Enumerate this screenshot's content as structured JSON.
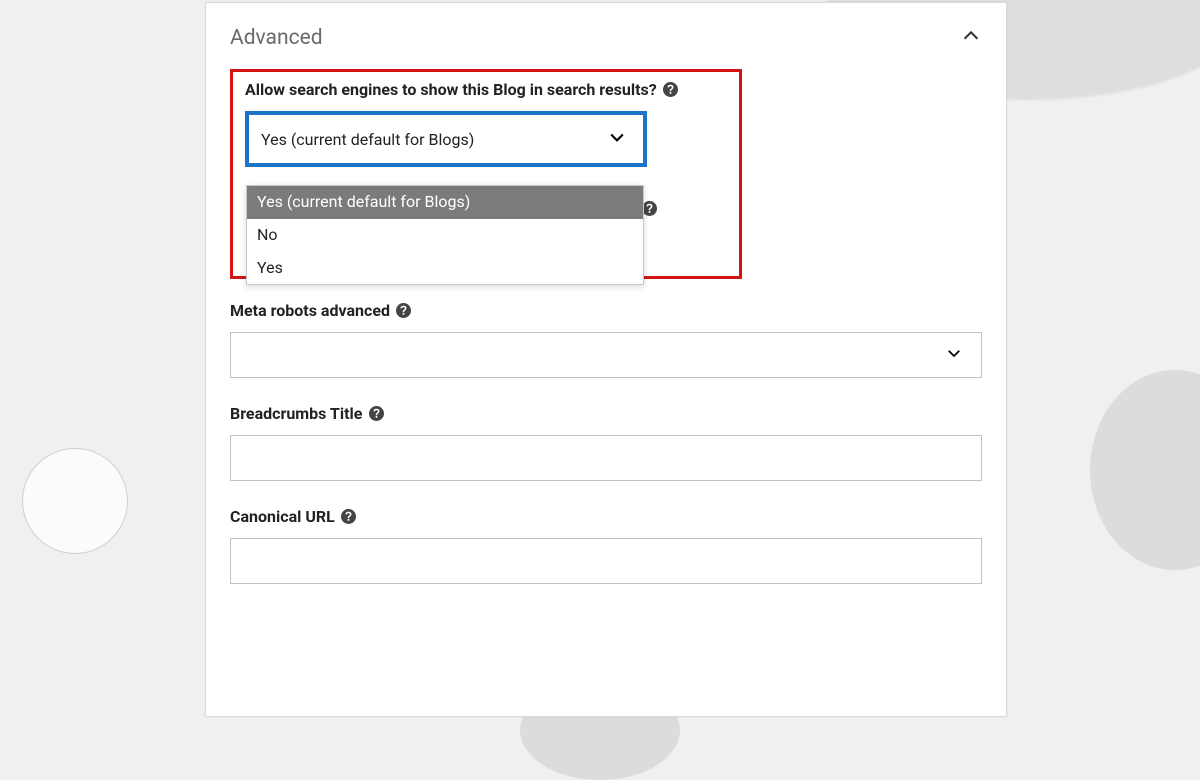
{
  "section": {
    "title": "Advanced"
  },
  "highlighted": {
    "label": "Allow search engines to show this Blog in search results?",
    "selected": "Yes (current default for Blogs)",
    "options": {
      "a": "Yes (current default for Blogs)",
      "b": "No",
      "c": "Yes"
    }
  },
  "meta_robots": {
    "label": "Meta robots advanced",
    "value": ""
  },
  "breadcrumbs": {
    "label": "Breadcrumbs Title",
    "value": ""
  },
  "canonical": {
    "label": "Canonical URL",
    "value": ""
  }
}
